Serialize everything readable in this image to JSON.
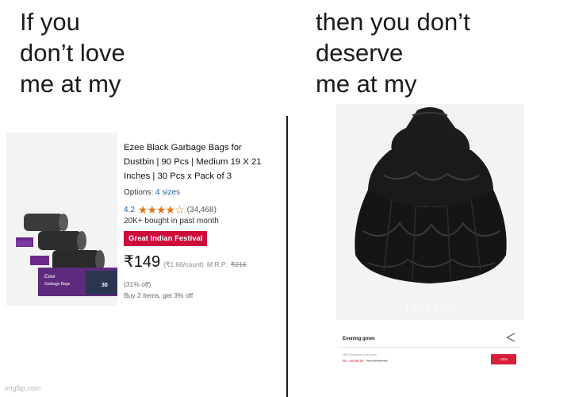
{
  "captions": {
    "left": "If you\ndon’t love\nme at my",
    "right": "then you don’t\ndeserve\nme at my"
  },
  "left_product": {
    "title": "Ezee Black Garbage Bags for Dustbin | 90 Pcs | Medium 19 X 21 Inches | 30 Pcs x Pack of 3",
    "options_label": "Options:",
    "options_value": "4 sizes",
    "rating": "4.2",
    "stars": "★★★★☆",
    "rating_count": "(34,468)",
    "bought": "20K+ bought in past month",
    "deal_badge": "Great Indian Festival",
    "price": "₹149",
    "unit_price": "(₹1.66/count)",
    "mrp_label": "M.R.P:",
    "mrp_value": "₹216",
    "discount": "(31% off)",
    "offer": "Buy 2 items, get 3% off",
    "package_brand": "Ezee",
    "package_label": "Garbage Bags",
    "package_count": "30"
  },
  "right_product": {
    "name": "Evening gown",
    "mrp_note": "MRP inclusive of all taxes",
    "price": "Rs. 19799.00",
    "old_price": "Rs. 47999.00",
    "off_badge": "-20%"
  },
  "watermark": "imgflip.com",
  "colors": {
    "deal_red": "#cc0c39",
    "star_orange": "#de7921",
    "link_blue": "#2162a1",
    "sale_red": "#d71f3a"
  },
  "icons": [
    "garbage-bag-rolls-image",
    "star-icon",
    "share-icon",
    "black-gown-image"
  ]
}
